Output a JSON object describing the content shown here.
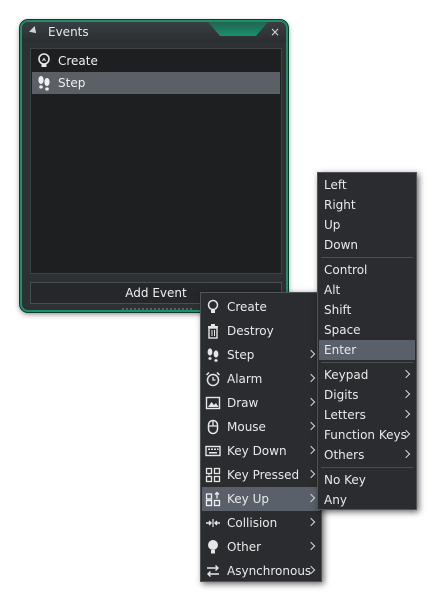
{
  "window": {
    "title": "Events",
    "close_glyph": "×"
  },
  "events": [
    {
      "label": "Create",
      "icon": "lightbulb-icon",
      "selected": false
    },
    {
      "label": "Step",
      "icon": "footprints-icon",
      "selected": true
    }
  ],
  "add_event_label": "Add Event",
  "context_menu": {
    "items": [
      {
        "label": "Create",
        "icon": "lightbulb-icon",
        "submenu": false
      },
      {
        "label": "Destroy",
        "icon": "trash-icon",
        "submenu": false
      },
      {
        "label": "Step",
        "icon": "footprints-icon",
        "submenu": true
      },
      {
        "label": "Alarm",
        "icon": "alarm-clock-icon",
        "submenu": true
      },
      {
        "label": "Draw",
        "icon": "draw-image-icon",
        "submenu": true
      },
      {
        "label": "Mouse",
        "icon": "mouse-icon",
        "submenu": true
      },
      {
        "label": "Key Down",
        "icon": "keyboard-icon",
        "submenu": true
      },
      {
        "label": "Key Pressed",
        "icon": "key-pressed-icon",
        "submenu": true
      },
      {
        "label": "Key Up",
        "icon": "key-up-icon",
        "submenu": true,
        "highlighted": true
      },
      {
        "label": "Collision",
        "icon": "collision-icon",
        "submenu": true
      },
      {
        "label": "Other",
        "icon": "other-bulb-icon",
        "submenu": true
      },
      {
        "label": "Asynchronous",
        "icon": "async-arrows-icon",
        "submenu": true
      }
    ]
  },
  "key_submenu": {
    "groups": [
      [
        {
          "label": "Left"
        },
        {
          "label": "Right"
        },
        {
          "label": "Up"
        },
        {
          "label": "Down"
        }
      ],
      [
        {
          "label": "Control"
        },
        {
          "label": "Alt"
        },
        {
          "label": "Shift"
        },
        {
          "label": "Space"
        },
        {
          "label": "Enter",
          "highlighted": true
        }
      ],
      [
        {
          "label": "Keypad",
          "submenu": true
        },
        {
          "label": "Digits",
          "submenu": true
        },
        {
          "label": "Letters",
          "submenu": true
        },
        {
          "label": "Function Keys",
          "submenu": true
        },
        {
          "label": "Others",
          "submenu": true
        }
      ],
      [
        {
          "label": "No Key"
        },
        {
          "label": "Any"
        }
      ]
    ]
  },
  "colors": {
    "window_border": "#1f8f6a",
    "panel_bg": "#2e3134",
    "list_bg": "#1e1f21",
    "highlight": "#59606a"
  }
}
